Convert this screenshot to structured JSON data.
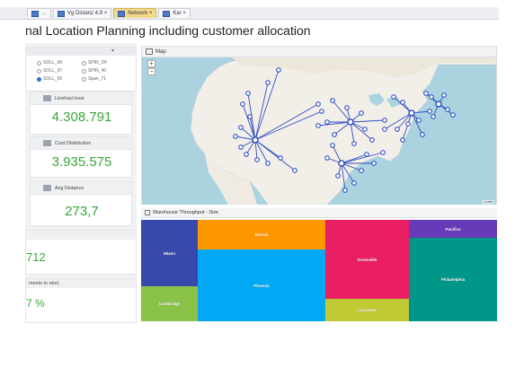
{
  "tabs": [
    {
      "label": "…",
      "active": false
    },
    {
      "label": "Vg Distanz 4.9 ×",
      "active": false
    },
    {
      "label": "Network ×",
      "active": true
    },
    {
      "label": "Kar ×",
      "active": false
    }
  ],
  "page_title": "nal Location Planning including customer allocation",
  "left_panel": {
    "radio_options": [
      {
        "label": "SOLL_96",
        "selected": false
      },
      {
        "label": "SPIN_OF",
        "selected": false
      },
      {
        "label": "SOLL_97",
        "selected": false
      },
      {
        "label": "SPIN_40",
        "selected": false
      },
      {
        "label": "SOLL_65",
        "selected": true
      },
      {
        "label": "Span_71",
        "selected": false
      }
    ],
    "kpis": [
      {
        "label": "Linehaul kost",
        "value": "4.308.791"
      },
      {
        "label": "Cost Distribution",
        "value": "3.935.575"
      },
      {
        "label": "Avg Distance",
        "value": "273,7"
      }
    ],
    "partial_value": "712",
    "partial_header": "ments to stor)",
    "partial_percent": "7 %"
  },
  "map": {
    "title": "Map",
    "zoom_in": "+",
    "zoom_out": "−",
    "attribution": "Leaflet"
  },
  "treemap": {
    "title": "Warehouse Throughput - Size",
    "cells": [
      {
        "label": "Miami",
        "color": "#3949ab"
      },
      {
        "label": "Cambridge",
        "color": "#8bc34a"
      },
      {
        "label": "Detroit",
        "color": "#ff9800"
      },
      {
        "label": "Phoenix",
        "color": "#03a9f4"
      },
      {
        "label": "Greenville",
        "color": "#e91e63"
      },
      {
        "label": "Lancaster",
        "color": "#c0ca33"
      },
      {
        "label": "Pacifica",
        "color": "#673ab7"
      },
      {
        "label": "Philadelphia",
        "color": "#009688"
      }
    ]
  },
  "colors": {
    "kpi_green": "#3aa63a",
    "route_blue": "#1f3fbf",
    "ocean": "#aad3df",
    "land": "#f2efe9"
  },
  "icons": [
    "window-icon",
    "tab-close-icon",
    "chart-icon",
    "map-icon",
    "treemap-icon",
    "radio-icon"
  ]
}
